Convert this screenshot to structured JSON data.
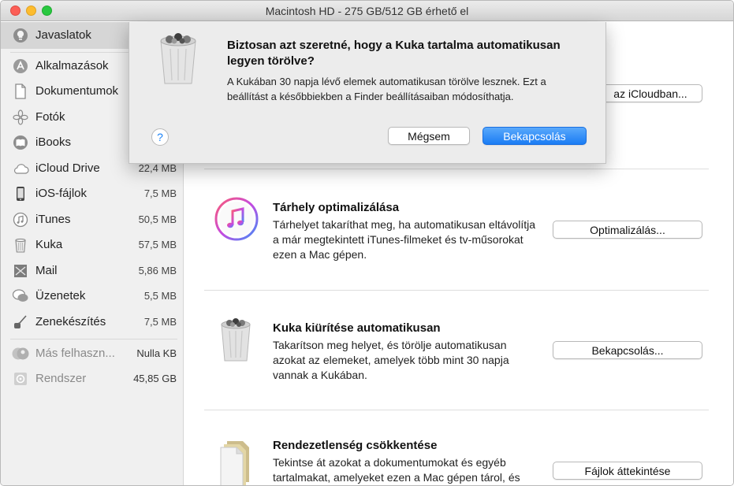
{
  "window": {
    "title": "Macintosh HD - 275 GB/512 GB érhető el"
  },
  "sidebar": {
    "top": {
      "label": "Javaslatok",
      "icon": "lightbulb-icon"
    },
    "items": [
      {
        "label": "Alkalmazások",
        "size": "",
        "icon": "applications-icon"
      },
      {
        "label": "Dokumentumok",
        "size": "",
        "icon": "document-icon"
      },
      {
        "label": "Fotók",
        "size": "",
        "icon": "photos-icon"
      },
      {
        "label": "iBooks",
        "size": "",
        "icon": "book-icon"
      },
      {
        "label": "iCloud Drive",
        "size": "22,4 MB",
        "icon": "cloud-icon"
      },
      {
        "label": "iOS-fájlok",
        "size": "7,5 MB",
        "icon": "iphone-icon"
      },
      {
        "label": "iTunes",
        "size": "50,5 MB",
        "icon": "music-note-icon"
      },
      {
        "label": "Kuka",
        "size": "57,5 MB",
        "icon": "trash-icon"
      },
      {
        "label": "Mail",
        "size": "5,86 MB",
        "icon": "mail-icon"
      },
      {
        "label": "Üzenetek",
        "size": "5,5 MB",
        "icon": "messages-icon"
      },
      {
        "label": "Zenekészítés",
        "size": "7,5 MB",
        "icon": "guitar-icon"
      }
    ],
    "other": [
      {
        "label": "Más felhaszn...",
        "size": "Nulla KB",
        "icon": "users-icon"
      },
      {
        "label": "Rendszer",
        "size": "45,85 GB",
        "icon": "system-disk-icon"
      }
    ]
  },
  "main": {
    "icloud_button": "az iCloudban...",
    "sections": [
      {
        "title": "Tárhely optimalizálása",
        "description": "Tárhelyet takaríthat meg, ha automatikusan eltávolítja a már megtekintett iTunes-filmeket és tv-műsorokat ezen a Mac gépen.",
        "button": "Optimalizálás..."
      },
      {
        "title": "Kuka kiürítése automatikusan",
        "description": "Takarítson meg helyet, és törölje automatikusan azokat az elemeket, amelyek több mint 30 napja vannak a Kukában.",
        "button": "Bekapcsolás..."
      },
      {
        "title": "Rendezetlenség csökkentése",
        "description": "Tekintse át azokat a dokumentumokat és egyéb tartalmakat, amelyeket ezen a Mac gépen tárol, és",
        "button": "Fájlok áttekintése"
      }
    ]
  },
  "dialog": {
    "title": "Biztosan azt szeretné, hogy a Kuka tartalma automatikusan legyen törölve?",
    "message": "A Kukában 30 napja lévő elemek automatikusan törölve lesznek. Ezt a beállítást a későbbiekben a Finder beállításaiban módosíthatja.",
    "help": "?",
    "cancel": "Mégsem",
    "confirm": "Bekapcsolás"
  },
  "colors": {
    "accent": "#1a7cf4",
    "sidebar_bg": "#f0f0f0",
    "selected_bg": "#d6d6d6"
  }
}
